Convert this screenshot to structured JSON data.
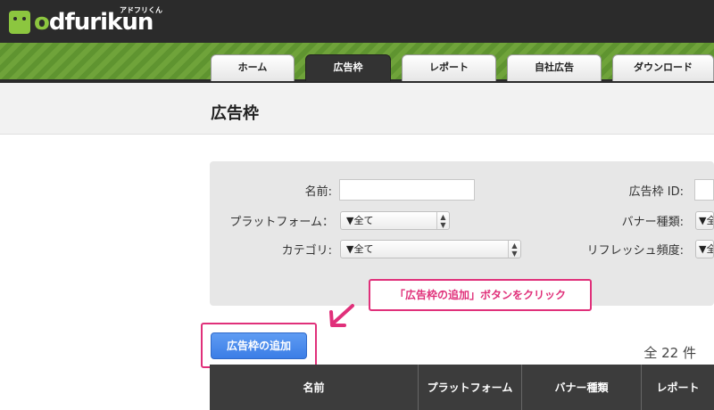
{
  "app": {
    "logo_prefix": "o",
    "logo_text": "dfurikun",
    "logo_subtitle": "アドフリくん"
  },
  "nav": {
    "tabs": [
      {
        "label": "ホーム",
        "active": false
      },
      {
        "label": "広告枠",
        "active": true
      },
      {
        "label": "レポート",
        "active": false
      },
      {
        "label": "自社広告",
        "active": false
      },
      {
        "label": "ダウンロード",
        "active": false
      }
    ]
  },
  "page": {
    "title": "広告枠"
  },
  "filter": {
    "name_label": "名前:",
    "name_value": "",
    "platform_label": "プラットフォーム：",
    "platform_value": "▼全て",
    "category_label": "カテゴリ:",
    "category_value": "▼全て",
    "slot_id_label": "広告枠 ID:",
    "slot_id_value": "",
    "banner_type_label": "バナー種類:",
    "banner_type_value": "▼全",
    "refresh_label": "リフレッシュ頻度:",
    "refresh_value": "▼全"
  },
  "annotation": {
    "callout_text": "「広告枠の追加」ボタンをクリック",
    "accent_color": "#e0307a"
  },
  "actions": {
    "add_slot_label": "広告枠の追加"
  },
  "list": {
    "count_text": "全 22 件",
    "columns": [
      "名前",
      "プラットフォーム",
      "バナー種類",
      "レポート"
    ]
  },
  "colors": {
    "header_bg": "#2b2b2b",
    "brand_green": "#8cc63f",
    "button_blue": "#3b7de6"
  }
}
